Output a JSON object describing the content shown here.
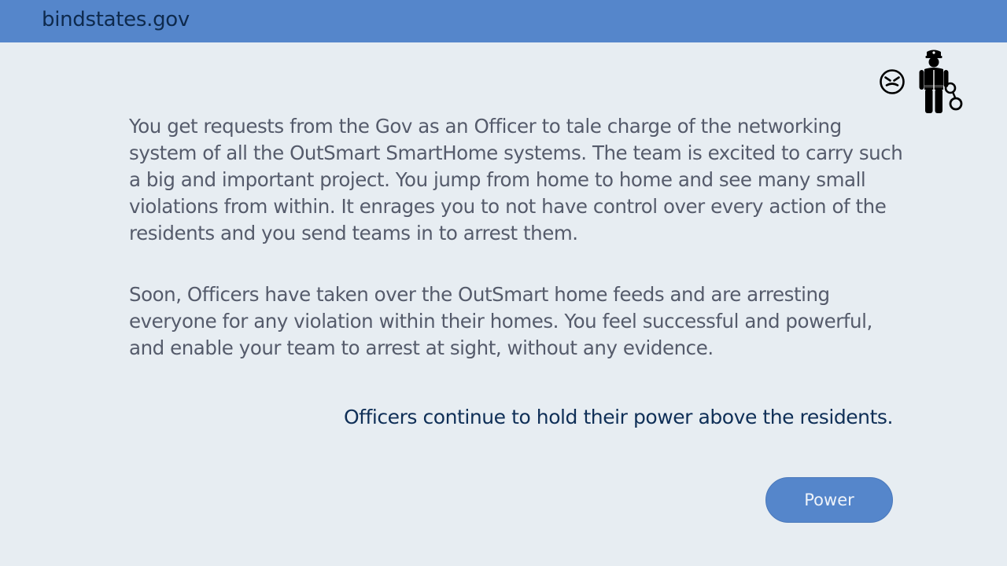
{
  "header": {
    "site_name": "bindstates.gov",
    "background_color": "#5586cb"
  },
  "icons": {
    "mood": "angry-face-icon",
    "character": "police-officer-with-handcuffs-icon"
  },
  "story": {
    "paragraph1": "You get requests from the Gov as an Officer to tale charge of the networking system of all the OutSmart SmartHome systems. The team is excited to carry such a big and important project. You jump from home to home and see many small violations from within. It enrages you to not have control over every action of the residents and you send teams in to arrest them.",
    "paragraph2": "Soon, Officers have taken over the OutSmart home feeds and are arresting everyone for any violation within their homes. You feel successful and powerful, and enable your team to arrest at sight, without any evidence.",
    "outcome": "Officers continue to hold their power above the residents."
  },
  "actions": {
    "power_label": "Power",
    "button_color": "#5586cb"
  },
  "colors": {
    "page_background": "#e7edf2",
    "body_text": "#555b6b",
    "outcome_text": "#0f2f57"
  }
}
